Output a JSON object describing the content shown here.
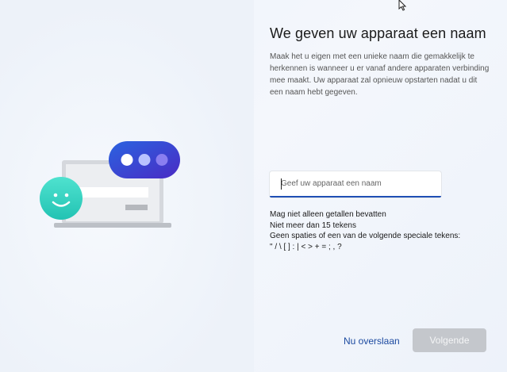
{
  "header": {
    "title": "We geven uw apparaat een naam"
  },
  "description": "Maak het u eigen met een unieke naam die gemakkelijk te herkennen is wanneer u er vanaf andere apparaten verbinding mee maakt. Uw apparaat zal opnieuw opstarten nadat u dit een naam hebt gegeven.",
  "name_input": {
    "value": "",
    "placeholder": "Geef uw apparaat een naam"
  },
  "rules": [
    "Mag niet alleen getallen bevatten",
    "Niet meer dan 15 tekens",
    "Geen spaties of een van de volgende speciale tekens:",
    "\" / \\ [ ] : | < > + = ; , ?"
  ],
  "buttons": {
    "skip_label": "Nu overslaan",
    "next_label": "Volgende"
  },
  "colors": {
    "accent": "#1f4fb5",
    "smiley": "#2ecfbf",
    "chat_bubble": "#3a45d4",
    "disabled_button": "#c4c7cc"
  },
  "illustration": {
    "icons": [
      "laptop-icon",
      "smiley-icon",
      "chat-bubble-icon"
    ]
  }
}
